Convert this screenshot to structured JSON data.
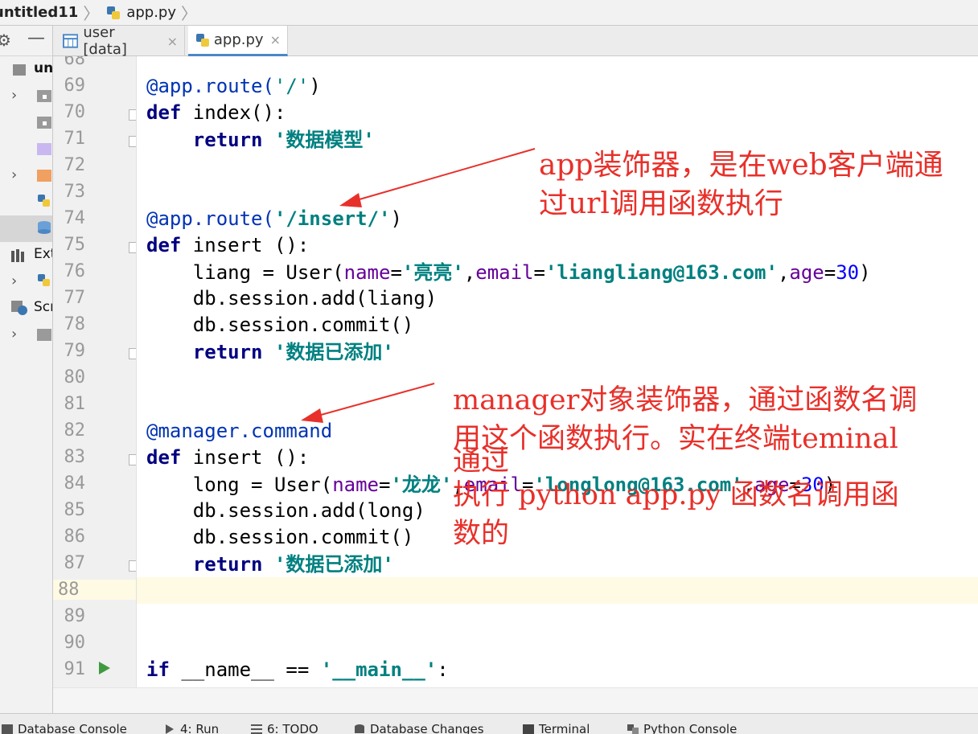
{
  "breadcrumb": {
    "project": "untitled11",
    "file": "app.py"
  },
  "tabs": [
    {
      "label": "user [data]",
      "close": "×"
    },
    {
      "label": "app.py",
      "close": "×"
    }
  ],
  "project_tree": {
    "row0": "un",
    "row6": "Ext",
    "row8": "Scr"
  },
  "line_numbers": [
    "68",
    "69",
    "70",
    "71",
    "72",
    "73",
    "74",
    "75",
    "76",
    "77",
    "78",
    "79",
    "80",
    "81",
    "82",
    "83",
    "84",
    "85",
    "86",
    "87",
    "88",
    "89",
    "90",
    "91"
  ],
  "code": {
    "l69": {
      "deco": "@app.route(",
      "str": "'/'",
      "tail": ")"
    },
    "l70": {
      "kw": "def",
      "rest": " index():"
    },
    "l71": {
      "kw": "return",
      "q1": " '",
      "cjk": "数据模型",
      "q2": "'"
    },
    "l74": {
      "deco": "@app.route(",
      "str": "'/insert/'",
      "tail": ")"
    },
    "l75": {
      "kw": "def",
      "rest": " insert ():"
    },
    "l76": {
      "a": "liang = User(",
      "p1": "name",
      "eq1": "=",
      "s1": "'",
      "c1": "亮亮",
      "s1b": "'",
      "comma1": ",",
      "p2": "email",
      "eq2": "=",
      "s2": "'liangliang@163.com'",
      "comma2": ",",
      "p3": "age",
      "eq3": "=",
      "n": "30",
      "end": ")"
    },
    "l77": "db.session.add(liang)",
    "l78": "db.session.commit()",
    "l79": {
      "kw": "return",
      "q1": " '",
      "cjk": "数据已添加",
      "q2": "'"
    },
    "l82": "@manager.command",
    "l83": {
      "kw": "def",
      "rest": " insert ():"
    },
    "l84": {
      "a": "long = User(",
      "p1": "name",
      "eq1": "=",
      "s1": "'",
      "c1": "龙龙",
      "s1b": "'",
      "comma1": ",",
      "p2": "email",
      "eq2": "=",
      "s2": "'longlong@163.com'",
      "comma2": ",",
      "p3": "age",
      "eq3": "=",
      "n": "30",
      "end": ")"
    },
    "l85": "db.session.add(long)",
    "l86": "db.session.commit()",
    "l87": {
      "kw": "return",
      "q1": " '",
      "cjk": "数据已添加",
      "q2": "'"
    },
    "l91": {
      "kw": "if",
      "mid": " __name__ == ",
      "str": "'__main__'",
      "end": ":"
    }
  },
  "annotations": {
    "note1": [
      "app装饰器，是在web客户端通",
      "过url调用函数执行"
    ],
    "note2": [
      "manager对象装饰器，通过函数名调",
      "用这个函数执行。实在终端teminal",
      "通过",
      "执行 python app.py 函数名调用函",
      "数的"
    ]
  },
  "bottom_tools": [
    "Database Console",
    "4: Run",
    "6: TODO",
    "Database Changes",
    "Terminal",
    "Python Console"
  ],
  "colors": {
    "annotation": "#e8302a",
    "string": "#008080",
    "keyword": "#000080",
    "param": "#660099",
    "number": "#0000ff"
  }
}
